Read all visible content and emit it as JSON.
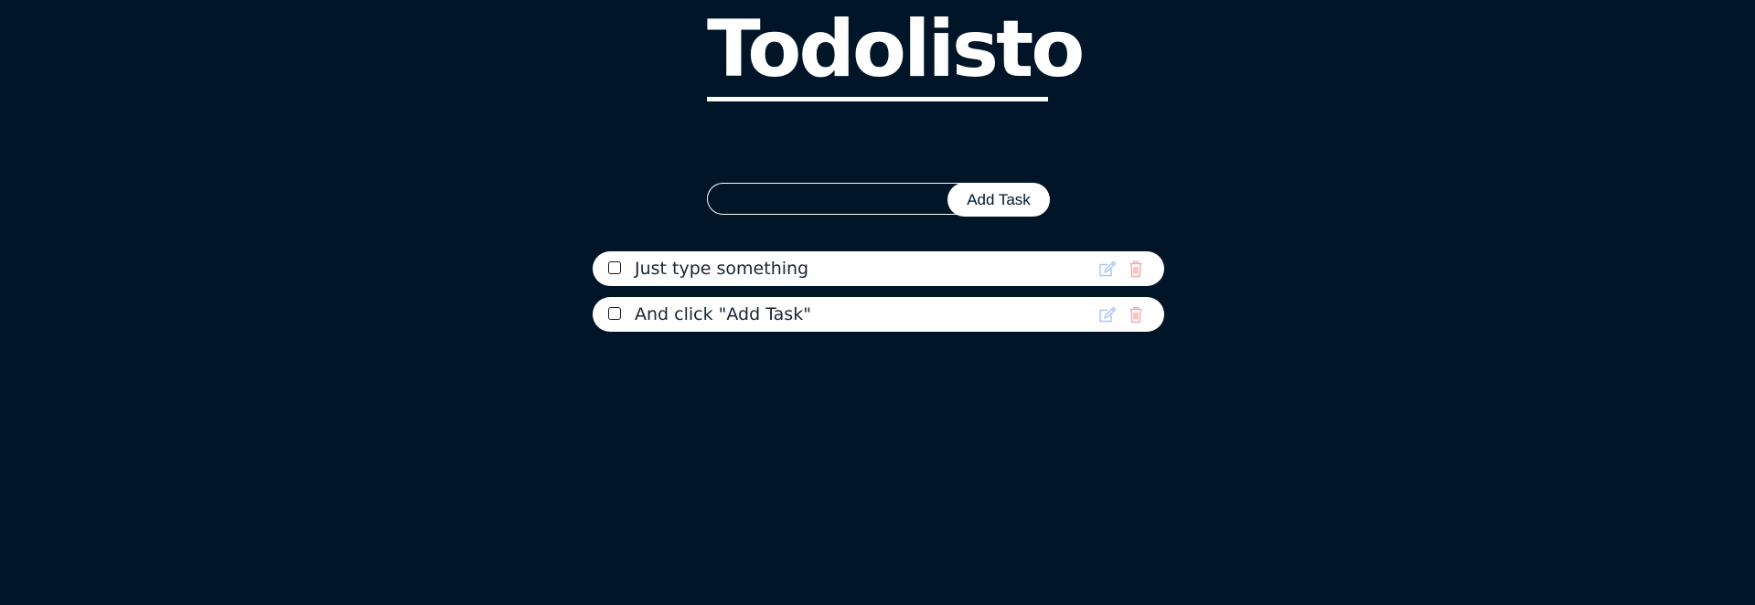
{
  "header": {
    "title": "Todolisto"
  },
  "form": {
    "input_value": "",
    "input_placeholder": "",
    "add_label": "Add Task"
  },
  "tasks": [
    {
      "text": "Just type something",
      "done": false
    },
    {
      "text": "And click \"Add Task\"",
      "done": false
    }
  ],
  "colors": {
    "background": "#001628",
    "text_light": "#ffffff",
    "task_text": "#1b2433",
    "edit_icon": "#a9c6f5",
    "delete_icon": "#f5aaaa"
  },
  "icons": {
    "edit": "edit-icon",
    "delete": "trash-icon"
  }
}
